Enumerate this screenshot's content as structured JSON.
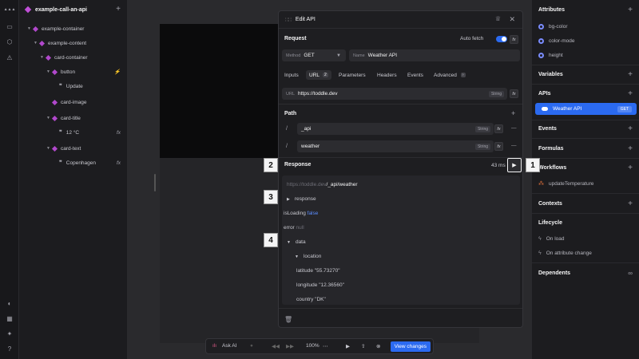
{
  "tree": {
    "title": "example-call-an-api",
    "nodes": [
      {
        "label": "example-container"
      },
      {
        "label": "example-content"
      },
      {
        "label": "card-container"
      },
      {
        "label": "button",
        "right": "⚡"
      },
      {
        "label": "Update"
      },
      {
        "label": "card-image"
      },
      {
        "label": "card-title"
      },
      {
        "label": "12 °C",
        "right": "fx"
      },
      {
        "label": "card-text"
      },
      {
        "label": "Copenhagen",
        "right": "fx"
      }
    ]
  },
  "modal": {
    "title": "Edit API",
    "request_label": "Request",
    "auto_fetch_label": "Auto fetch",
    "method_key": "Method",
    "method_value": "GET",
    "name_key": "Name",
    "name_value": "Weather API",
    "tabs": [
      {
        "label": "Inputs"
      },
      {
        "label": "URL",
        "count": "2"
      },
      {
        "label": "Parameters"
      },
      {
        "label": "Headers"
      },
      {
        "label": "Events"
      },
      {
        "label": "Advanced"
      }
    ],
    "url_key": "URL",
    "url_value": "https://toddle.dev",
    "url_type": "String",
    "path_label": "Path",
    "path_items": [
      {
        "slash": "/",
        "value": "_api",
        "type": "String"
      },
      {
        "slash": "/",
        "value": "weather",
        "type": "String"
      }
    ],
    "response_label": "Response",
    "response_time": "43 ms",
    "resp_url_base": "https://toddle.dev",
    "resp_url_path": "/_api/weather",
    "resp_response": "response",
    "isloading_key": "isLoading",
    "isloading_val": "false",
    "error_key": "error",
    "error_val": "null",
    "data_key": "data",
    "location_key": "location",
    "latitude_key": "latitude",
    "latitude_val": "\"55.73270\"",
    "longitude_key": "longitude",
    "longitude_val": "\"12.36560\"",
    "country_key": "country",
    "country_val": "\"DK\"",
    "markers": [
      "1",
      "2",
      "3",
      "4"
    ]
  },
  "right": {
    "attributes": "Attributes",
    "attr_items": [
      "bg-color",
      "color-mode",
      "height"
    ],
    "variables": "Variables",
    "apis": "APIs",
    "api_selected": "Weather API",
    "api_method": "GET",
    "events": "Events",
    "formulas": "Formulas",
    "workflows": "Workflows",
    "workflow_item": "updateTemperature",
    "contexts": "Contexts",
    "lifecycle": "Lifecycle",
    "on_load": "On load",
    "on_attr_change": "On attribute change",
    "dependents": "Dependents"
  },
  "bottom": {
    "ask_ai": "Ask AI",
    "zoom": "100%",
    "view_changes": "View changes"
  }
}
